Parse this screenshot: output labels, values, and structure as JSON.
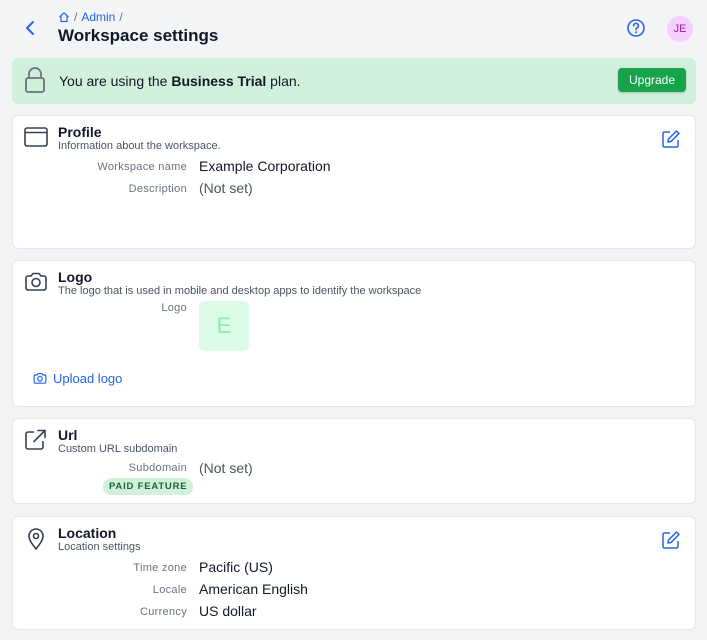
{
  "header": {
    "breadcrumb": [
      "Admin"
    ],
    "breadcrumb_sep": "/",
    "title": "Workspace settings",
    "avatar_initials": "JE"
  },
  "banner": {
    "prefix": "You are using the ",
    "plan": "Business Trial",
    "suffix": " plan.",
    "upgrade_label": "Upgrade"
  },
  "profile": {
    "title": "Profile",
    "subtitle": "Information about the workspace.",
    "fields": [
      {
        "label": "Workspace name",
        "value": "Example Corporation"
      },
      {
        "label": "Description",
        "value": "(Not set)"
      }
    ]
  },
  "logo": {
    "title": "Logo",
    "subtitle": "The logo that is used in mobile and desktop apps to identify the workspace",
    "label": "Logo",
    "initial": "E",
    "upload_label": "Upload logo"
  },
  "url": {
    "title": "Url",
    "subtitle": "Custom URL subdomain",
    "label": "Subdomain",
    "value": "(Not set)",
    "badge": "PAID FEATURE"
  },
  "location": {
    "title": "Location",
    "subtitle": "Location settings",
    "fields": [
      {
        "label": "Time zone",
        "value": "Pacific (US)"
      },
      {
        "label": "Locale",
        "value": "American English"
      },
      {
        "label": "Currency",
        "value": "US dollar"
      }
    ]
  },
  "icons": {
    "back": "chevron-left-icon",
    "home": "home-icon",
    "help": "help-circle-icon",
    "lock": "lock-icon",
    "profile": "window-icon",
    "logo": "camera-icon",
    "url": "external-link-icon",
    "location": "map-pin-icon",
    "edit": "edit-icon"
  },
  "colors": {
    "accent": "#2563eb",
    "upgrade": "#16a34a",
    "banner_bg": "#d1f0dc",
    "avatar_bg": "#f5d0fe",
    "avatar_fg": "#a21caf"
  }
}
